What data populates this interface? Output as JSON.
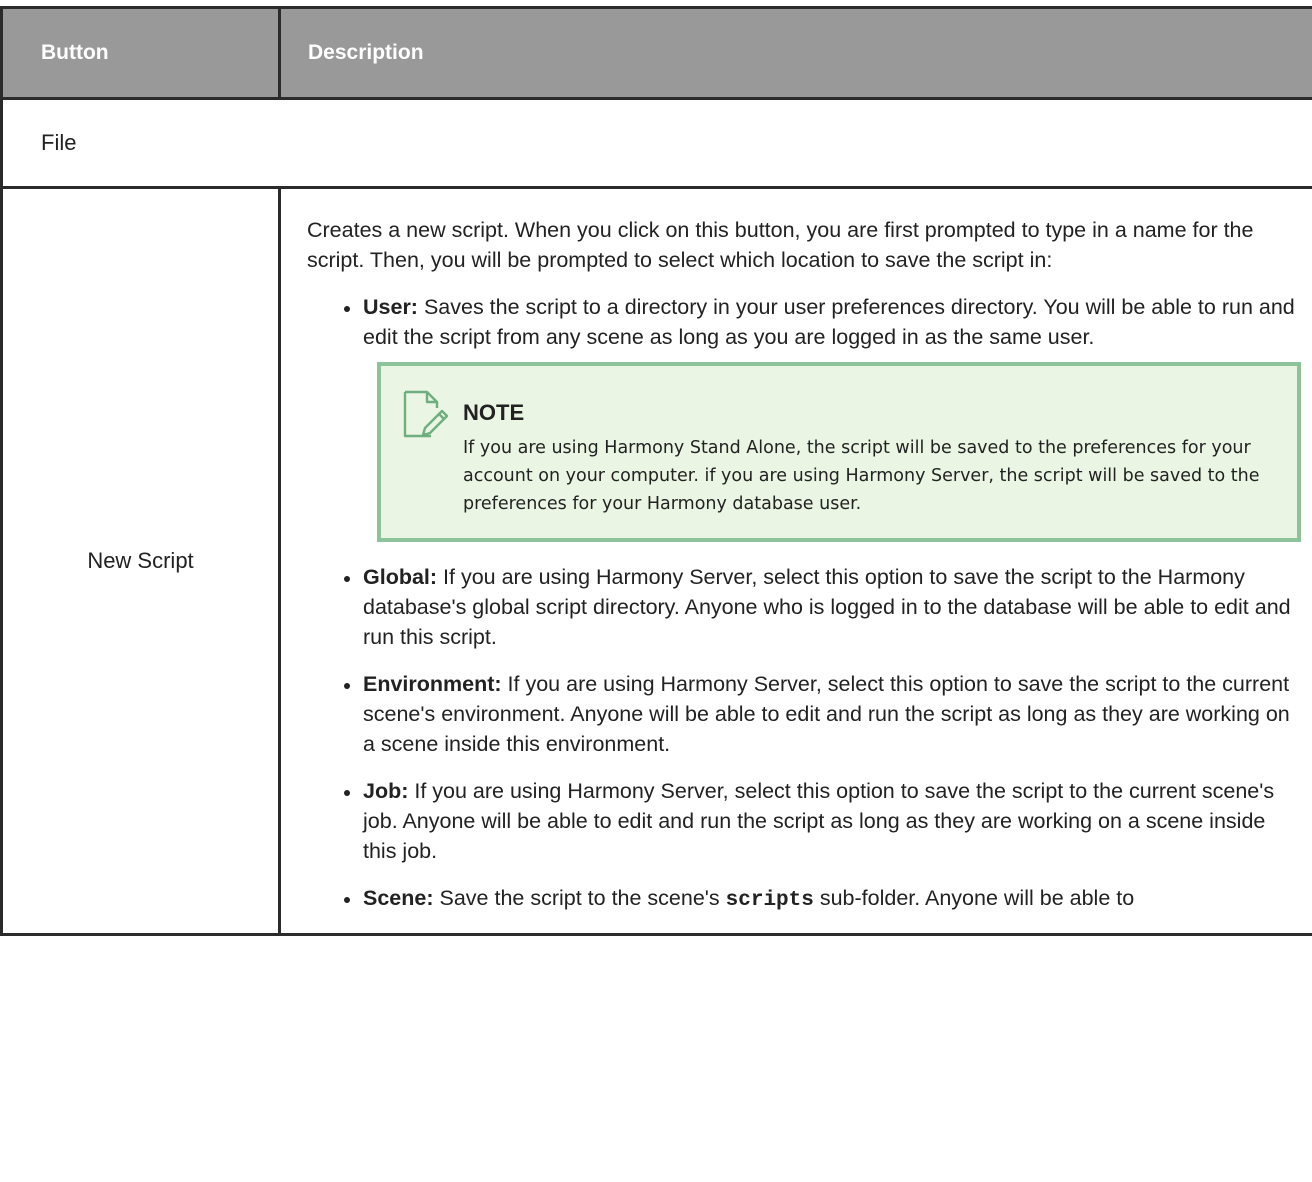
{
  "table": {
    "headers": {
      "button": "Button",
      "description": "Description"
    },
    "section": "File",
    "row": {
      "button_label": "New Script",
      "intro": "Creates a new script. When you click on this button, you are first prompted to type in a name for the script. Then, you will be prompted to select which location to save the script in:",
      "options": [
        {
          "term": "User:",
          "text": " Saves the script to a directory in your user preferences directory. You will be able to run and edit the script from any scene as long as you are logged in as the same user."
        },
        {
          "term": "Global:",
          "text": " If you are using Harmony Server, select this option to save the script to the Harmony database's global script directory. Anyone who is logged in to the database will be able to edit and run this script."
        },
        {
          "term": "Environment:",
          "text": " If you are using Harmony Server, select this option to save the script to the current scene's environment. Anyone will be able to edit and run the script as long as they are working on a scene inside this environment."
        },
        {
          "term": "Job:",
          "text": " If you are using Harmony Server, select this option to save the script to the current scene's job. Anyone will be able to edit and run the script as long as they are working on a scene inside this job."
        },
        {
          "term": "Scene:",
          "text_before": " Save the script to the scene's ",
          "code": "scripts",
          "text_after": " sub-folder. Anyone will be able to"
        }
      ],
      "note": {
        "icon": "note-edit-icon",
        "title": "NOTE",
        "text": "If you are using Harmony Stand Alone, the script will be saved to the preferences for your account on your computer. if you are using Harmony Server, the script will be saved to the preferences for your Harmony database user."
      }
    }
  },
  "colors": {
    "header_bg": "#999999",
    "header_text": "#ffffff",
    "border": "#2b2b2b",
    "note_border": "#8ec39a",
    "note_bg": "#eaf5e3",
    "note_icon": "#6fae7e"
  }
}
